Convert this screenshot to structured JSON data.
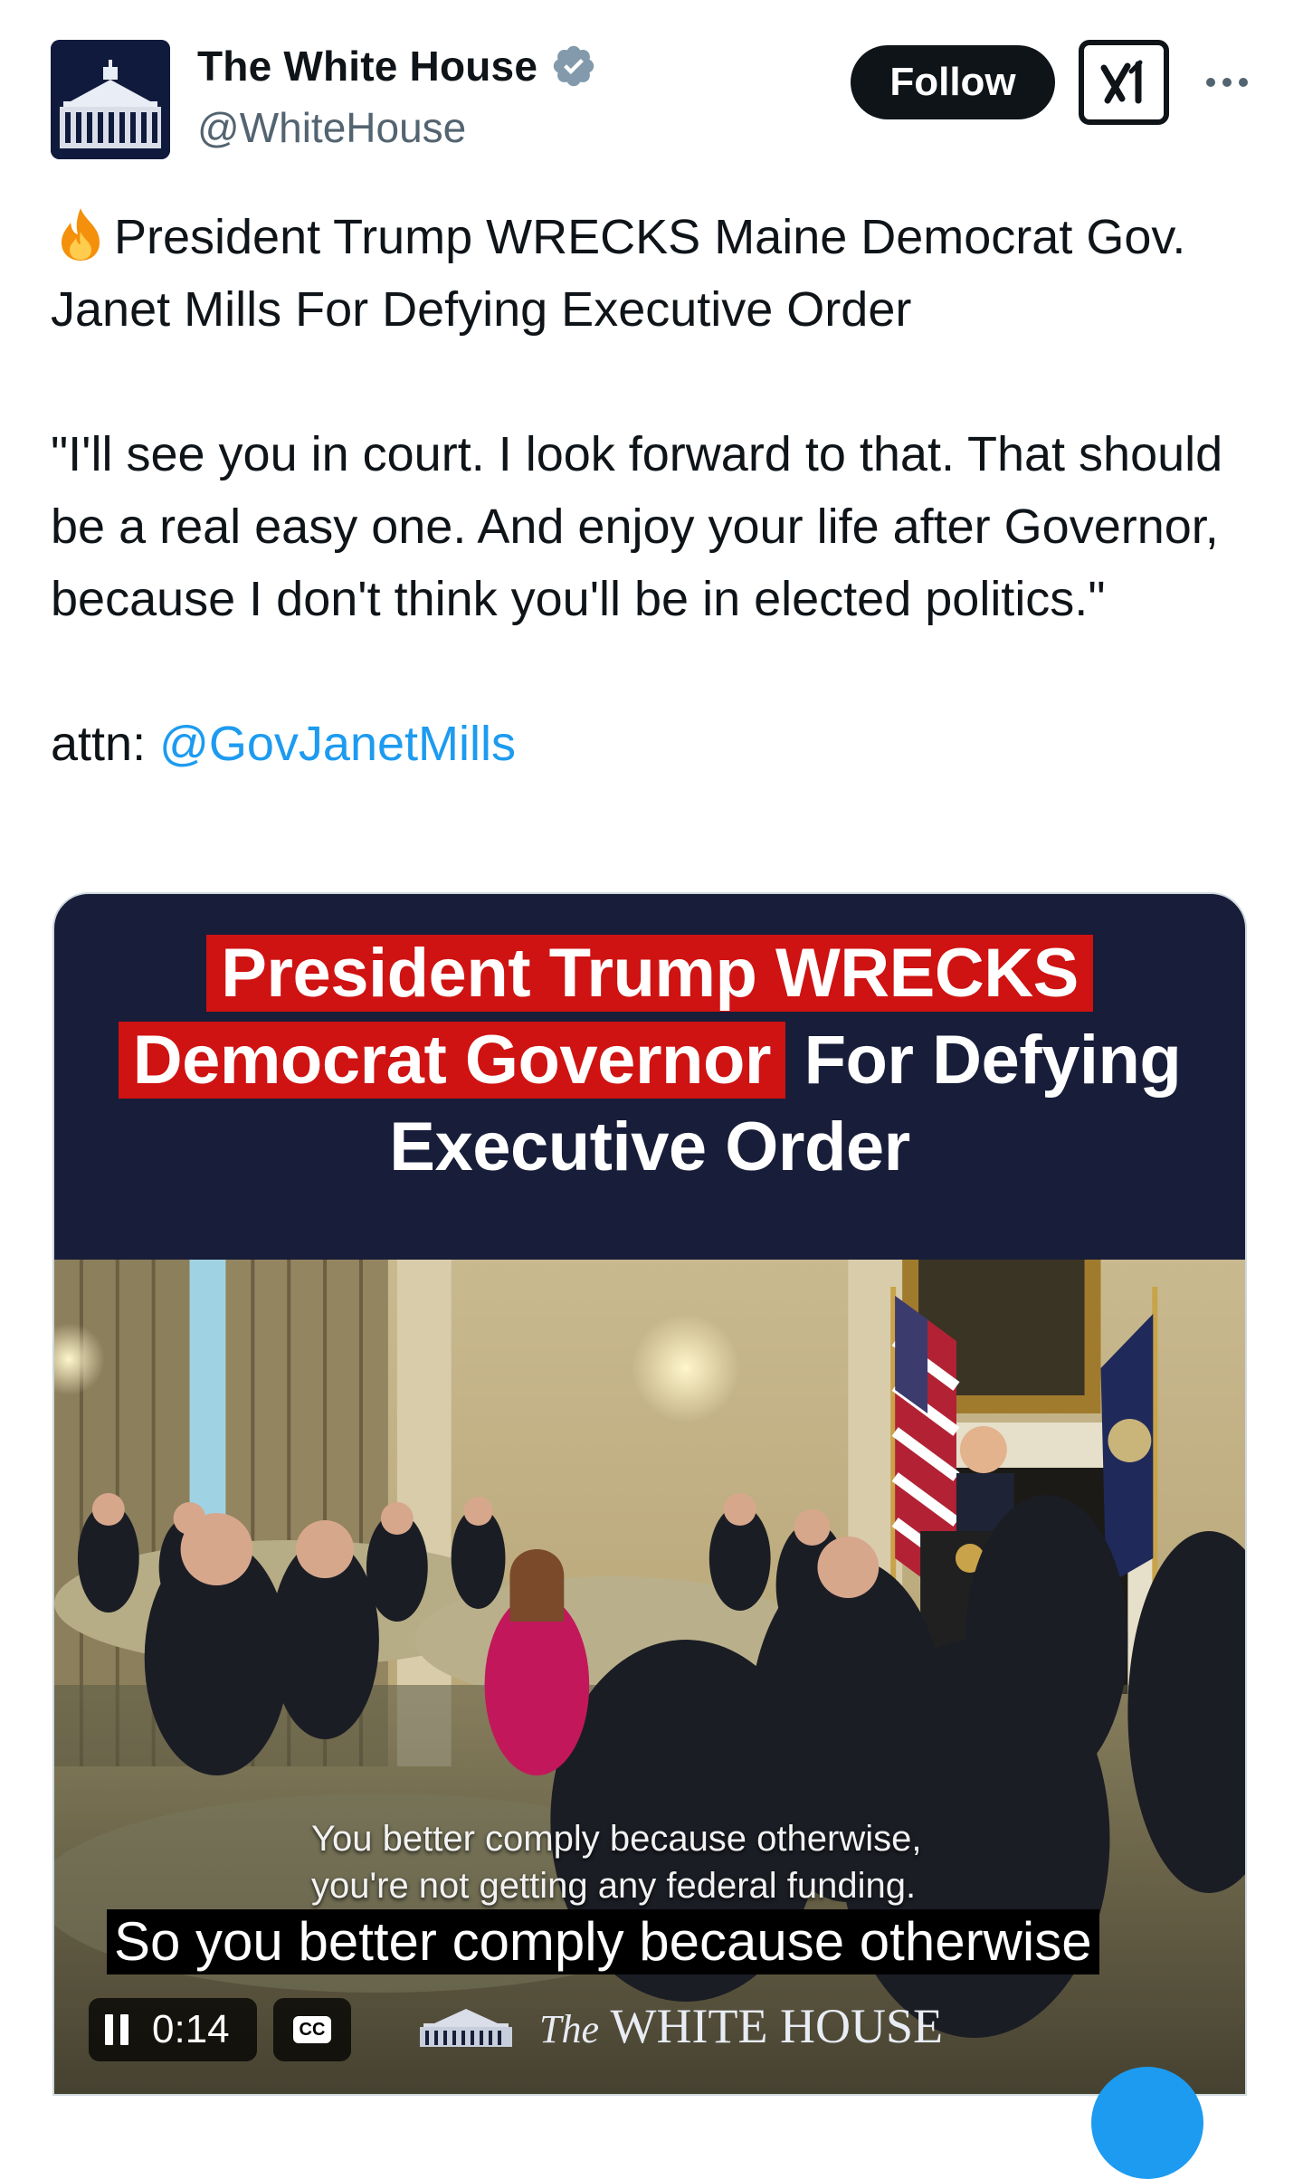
{
  "account": {
    "name": "The White House",
    "handle": "@WhiteHouse",
    "verified": true,
    "avatar_icon": "white-house-building-icon"
  },
  "actions": {
    "follow_label": "Follow",
    "grok_icon": "grok-icon",
    "more_icon": "more-horizontal-icon"
  },
  "tweet": {
    "emoji": "fire-emoji",
    "line1": "President Trump WRECKS Maine Democrat Gov. Janet Mills For Defying Executive Order",
    "quote": "\"I'll see you in court. I look forward to that. That should be a real easy one. And enjoy your life after Governor, because I don't think you'll be in elected politics.\"",
    "attn_prefix": "attn: ",
    "mention": "@GovJanetMills"
  },
  "video": {
    "headline_red_1": "President Trump WRECKS",
    "headline_red_2": "Democrat Governor",
    "headline_white_2": "For Defying",
    "headline_white_3": "Executive Order",
    "subtitle_line1": "You better comply because otherwise,",
    "subtitle_line2": "you're not getting any federal funding.",
    "caption": "So you better comply because otherwise",
    "time": "0:14",
    "cc_label": "CC",
    "watermark_prefix": "The",
    "watermark_name": "WHITE HOUSE"
  },
  "colors": {
    "accent": "#1d9bf0",
    "headline_red": "#cf1212",
    "video_bg": "#181d39",
    "text": "#0f1419",
    "secondary": "#536471"
  }
}
